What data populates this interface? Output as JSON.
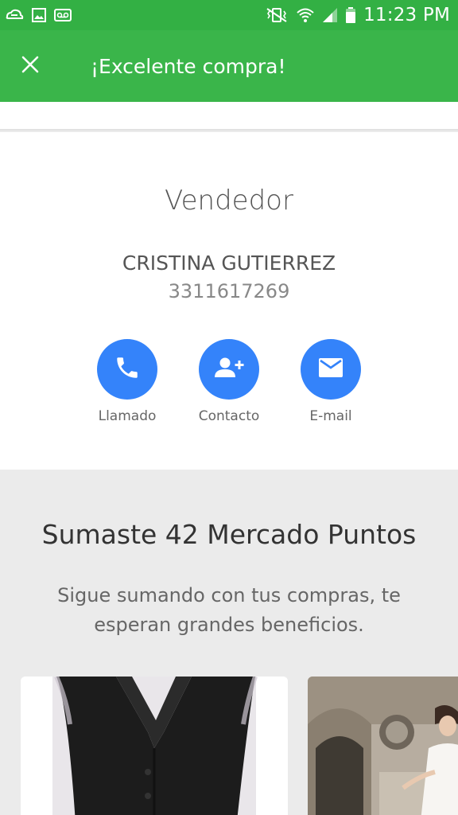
{
  "status_bar": {
    "time": "11:23 PM",
    "left_icons": [
      "cloud-sync-icon",
      "image-icon",
      "voicemail-icon"
    ],
    "right_icons": [
      "vibrate-mute-icon",
      "wifi-icon",
      "signal-icon",
      "battery-icon"
    ]
  },
  "app_bar": {
    "title": "¡Excelente compra!",
    "close_icon": "close-icon",
    "color": "#3ab54a"
  },
  "seller": {
    "heading": "Vendedor",
    "name": "CRISTINA GUTIERREZ",
    "phone": "3311617269",
    "actions": [
      {
        "label": "Llamado",
        "icon": "phone-icon"
      },
      {
        "label": "Contacto",
        "icon": "add-contact-icon"
      },
      {
        "label": "E-mail",
        "icon": "mail-icon"
      }
    ],
    "accent": "#3483fa"
  },
  "points": {
    "title": "Sumaste 42 Mercado Puntos",
    "subtitle": "Sigue sumando con tus compras, te esperan grandes beneficios."
  },
  "products": [
    {
      "image": "black-vest-photo"
    },
    {
      "image": "bridal-dress-photo"
    }
  ]
}
